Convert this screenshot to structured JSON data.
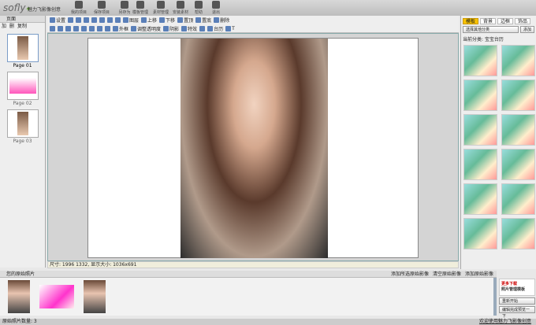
{
  "app": {
    "logo": "sofly",
    "title": "魅力飞影像创意"
  },
  "toolbar": [
    "我的项目",
    "保存项目",
    "另存为",
    "模板管理",
    "素材管理",
    "安装素材",
    "帮助",
    "退出"
  ],
  "left": {
    "header": "页面",
    "buttons": [
      "加",
      "删",
      "复制"
    ],
    "pages": [
      "Page 01",
      "Page 02",
      "Page 03"
    ]
  },
  "edit_row1": [
    "设置",
    "",
    "",
    "",
    "",
    "",
    "",
    "",
    "图层",
    "上移",
    "下移",
    "置顶",
    "置底",
    "删除"
  ],
  "edit_row2": [
    "",
    "",
    "",
    "",
    "",
    "",
    "",
    "",
    "外框",
    "调整透明度",
    "阴影",
    "特效",
    "",
    "台历",
    "T"
  ],
  "status": "尺寸: 1996 1332, 显示大小: 1036x691",
  "right": {
    "tabs": [
      "模板",
      "背景",
      "边框",
      "饰品"
    ],
    "select_category": "选择其他分类",
    "add": "添加",
    "current_category": "当前分类: 宝宝台历"
  },
  "bottom": {
    "header": "您的原始照片",
    "actions": [
      "添加所选原始影像",
      "清空原始影像",
      "添加原始影像"
    ],
    "more_download": "更多下载",
    "more_sub": "照片管理模板",
    "restart": "重新开始",
    "preview": "编辑完成预览一下"
  },
  "footer": {
    "count": "原始照片数量: 3",
    "welcome": "欢迎使用魅力飞影像创意"
  }
}
